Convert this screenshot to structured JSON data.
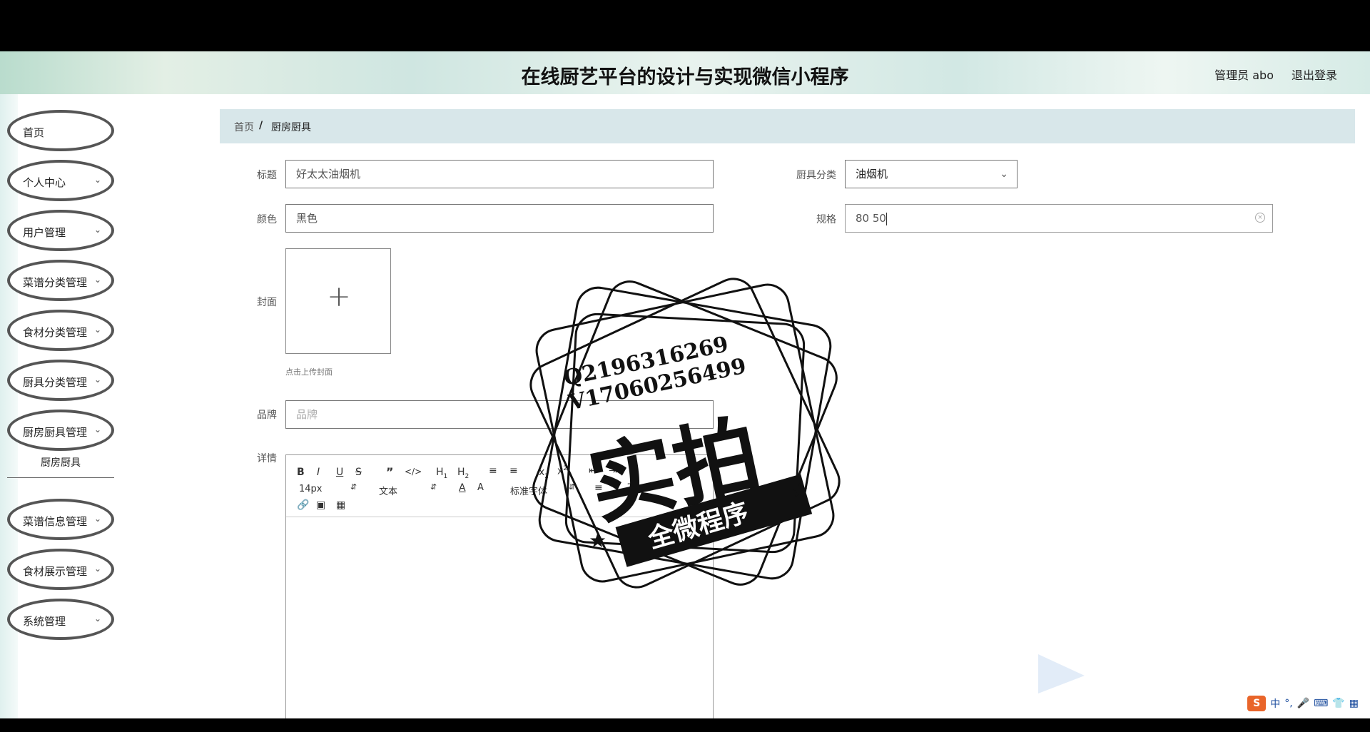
{
  "header": {
    "title": "在线厨艺平台的设计与实现微信小程序",
    "user": "管理员 abo",
    "logout": "退出登录"
  },
  "sidebar": {
    "items": [
      {
        "label": "首页"
      },
      {
        "label": "个人中心"
      },
      {
        "label": "用户管理"
      },
      {
        "label": "菜谱分类管理"
      },
      {
        "label": "食材分类管理"
      },
      {
        "label": "厨具分类管理"
      },
      {
        "label": "厨房厨具管理"
      },
      {
        "label": "菜谱信息管理"
      },
      {
        "label": "食材展示管理"
      },
      {
        "label": "系统管理"
      }
    ],
    "submenu": "厨房厨具"
  },
  "breadcrumb": {
    "home": "首页",
    "separator": "/",
    "current": "厨房厨具"
  },
  "form": {
    "title_label": "标题",
    "title_value": "好太太油烟机",
    "category_label": "厨具分类",
    "category_value": "油烟机",
    "color_label": "颜色",
    "color_value": "黑色",
    "spec_label": "规格",
    "spec_value": "80 50",
    "cover_label": "封面",
    "cover_hint": "点击上传封面",
    "brand_label": "品牌",
    "brand_placeholder": "品牌",
    "detail_label": "详情"
  },
  "editor": {
    "font_size": "14px",
    "paragraph": "文本",
    "font_family": "标准字体"
  },
  "stamp": {
    "line1": "Q2196316269",
    "line2": "V17060256499",
    "big": "实拍",
    "banner": "全微程序"
  },
  "ime": {
    "logo": "S",
    "lang": "中"
  }
}
